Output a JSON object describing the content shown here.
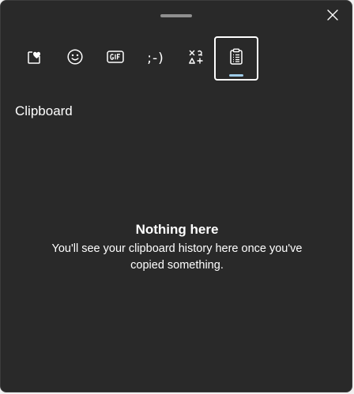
{
  "panel": {
    "section_title": "Clipboard"
  },
  "tabs": [
    {
      "name": "favorites",
      "icon": "kaomoji-heart-card-icon",
      "label": ""
    },
    {
      "name": "emoji",
      "icon": "smiley-face-icon",
      "label": ""
    },
    {
      "name": "gif",
      "icon": "gif-icon",
      "label": ""
    },
    {
      "name": "kaomoji",
      "icon": "kaomoji-icon",
      "label": ";-)"
    },
    {
      "name": "symbols",
      "icon": "symbols-icon",
      "label": ""
    },
    {
      "name": "clipboard-history",
      "icon": "clipboard-icon",
      "label": "",
      "selected": true
    }
  ],
  "empty_state": {
    "heading": "Nothing here",
    "body": "You'll see your clipboard history here once you've copied something."
  },
  "colors": {
    "background": "#292929",
    "accent_indicator": "#9ecbe8",
    "text": "#ffffff"
  }
}
